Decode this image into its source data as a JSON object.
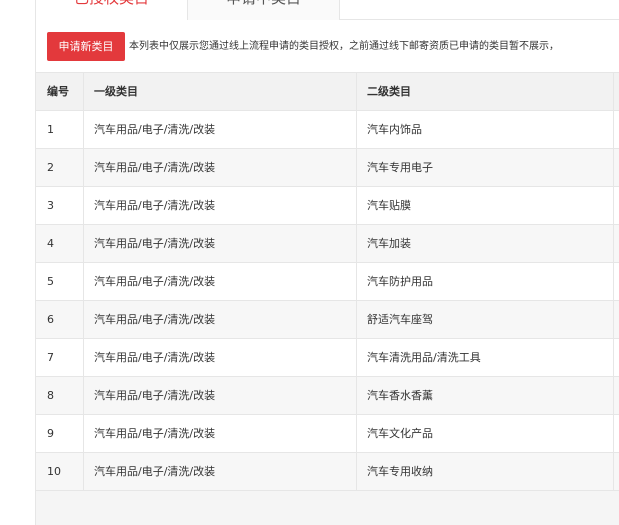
{
  "tabs": [
    {
      "label": "已授权类目"
    },
    {
      "label": "申请中类目"
    }
  ],
  "toolbar": {
    "apply_label": "申请新类目",
    "notice": "本列表中仅展示您通过线上流程申请的类目授权，之前通过线下邮寄资质已申请的类目暂不展示，"
  },
  "table": {
    "headers": {
      "no": "编号",
      "level1": "一级类目",
      "level2": "二级类目"
    },
    "rows": [
      {
        "no": "1",
        "level1": "汽车用品/电子/清洗/改装",
        "level2": "汽车内饰品"
      },
      {
        "no": "2",
        "level1": "汽车用品/电子/清洗/改装",
        "level2": "汽车专用电子"
      },
      {
        "no": "3",
        "level1": "汽车用品/电子/清洗/改装",
        "level2": "汽车贴膜"
      },
      {
        "no": "4",
        "level1": "汽车用品/电子/清洗/改装",
        "level2": "汽车加装"
      },
      {
        "no": "5",
        "level1": "汽车用品/电子/清洗/改装",
        "level2": "汽车防护用品"
      },
      {
        "no": "6",
        "level1": "汽车用品/电子/清洗/改装",
        "level2": "舒适汽车座驾"
      },
      {
        "no": "7",
        "level1": "汽车用品/电子/清洗/改装",
        "level2": "汽车清洗用品/清洗工具"
      },
      {
        "no": "8",
        "level1": "汽车用品/电子/清洗/改装",
        "level2": "汽车香水香薰"
      },
      {
        "no": "9",
        "level1": "汽车用品/电子/清洗/改装",
        "level2": "汽车文化产品"
      },
      {
        "no": "10",
        "level1": "汽车用品/电子/清洗/改装",
        "level2": "汽车专用收纳"
      }
    ]
  },
  "colors": {
    "accent": "#e3393c",
    "border": "#e6e6e6",
    "header_bg": "#f2f2f2"
  }
}
